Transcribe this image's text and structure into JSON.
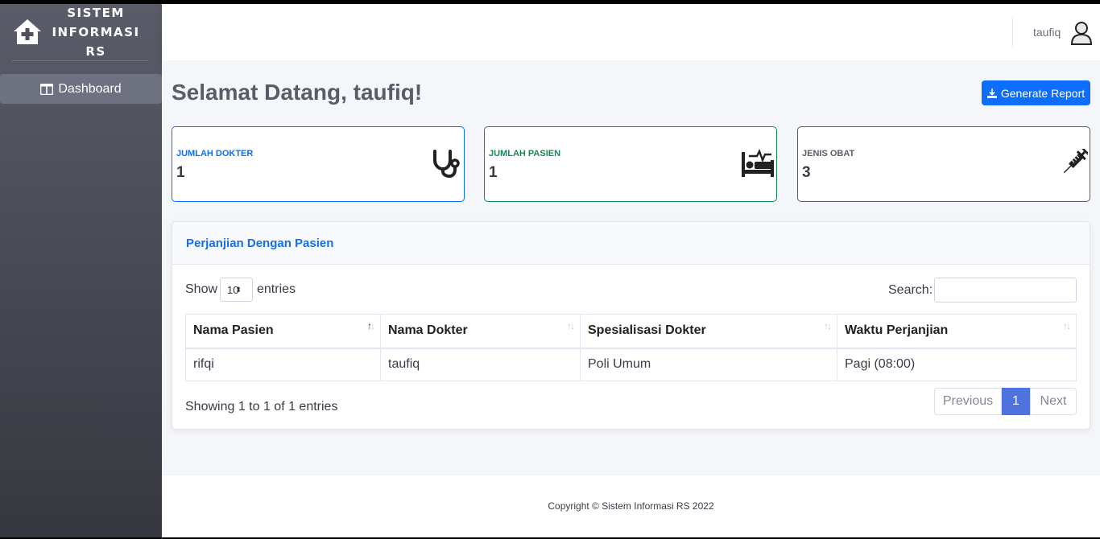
{
  "sidebar": {
    "brand": [
      "SISTEM",
      "INFORMASI",
      "RS"
    ],
    "items": [
      {
        "label": "Dashboard",
        "icon": "columns-icon"
      }
    ]
  },
  "topbar": {
    "username": "taufiq",
    "avatar_icon": "user-icon"
  },
  "page": {
    "title": "Selamat Datang, taufiq!",
    "report_button": "Generate Report"
  },
  "stats": [
    {
      "label": "JUMLAH DOKTER",
      "value": "1",
      "icon": "stethoscope-icon",
      "color": "#0d6efd"
    },
    {
      "label": "JUMLAH PASIEN",
      "value": "1",
      "icon": "bed-pulse-icon",
      "color": "#198754"
    },
    {
      "label": "JENIS OBAT",
      "value": "3",
      "icon": "syringe-icon",
      "color": "#5a5c69"
    }
  ],
  "appointments": {
    "title": "Perjanjian Dengan Pasien",
    "show_label": "Show",
    "entries_value": "10",
    "entries_label": "entries",
    "search_label": "Search:",
    "columns": [
      "Nama Pasien",
      "Nama Dokter",
      "Spesialisasi Dokter",
      "Waktu Perjanjian"
    ],
    "rows": [
      [
        "rifqi",
        "taufiq",
        "Poli Umum",
        "Pagi (08:00)"
      ]
    ],
    "info": "Showing 1 to 1 of 1 entries",
    "pagination": {
      "previous": "Previous",
      "current": "1",
      "next": "Next"
    }
  },
  "footer": {
    "text": "Copyright © Sistem Informasi RS 2022"
  },
  "colors": {
    "accent": "#0d6efd",
    "success": "#198754",
    "sidebar": "#4e4f59",
    "page_active": "#4e73df"
  }
}
